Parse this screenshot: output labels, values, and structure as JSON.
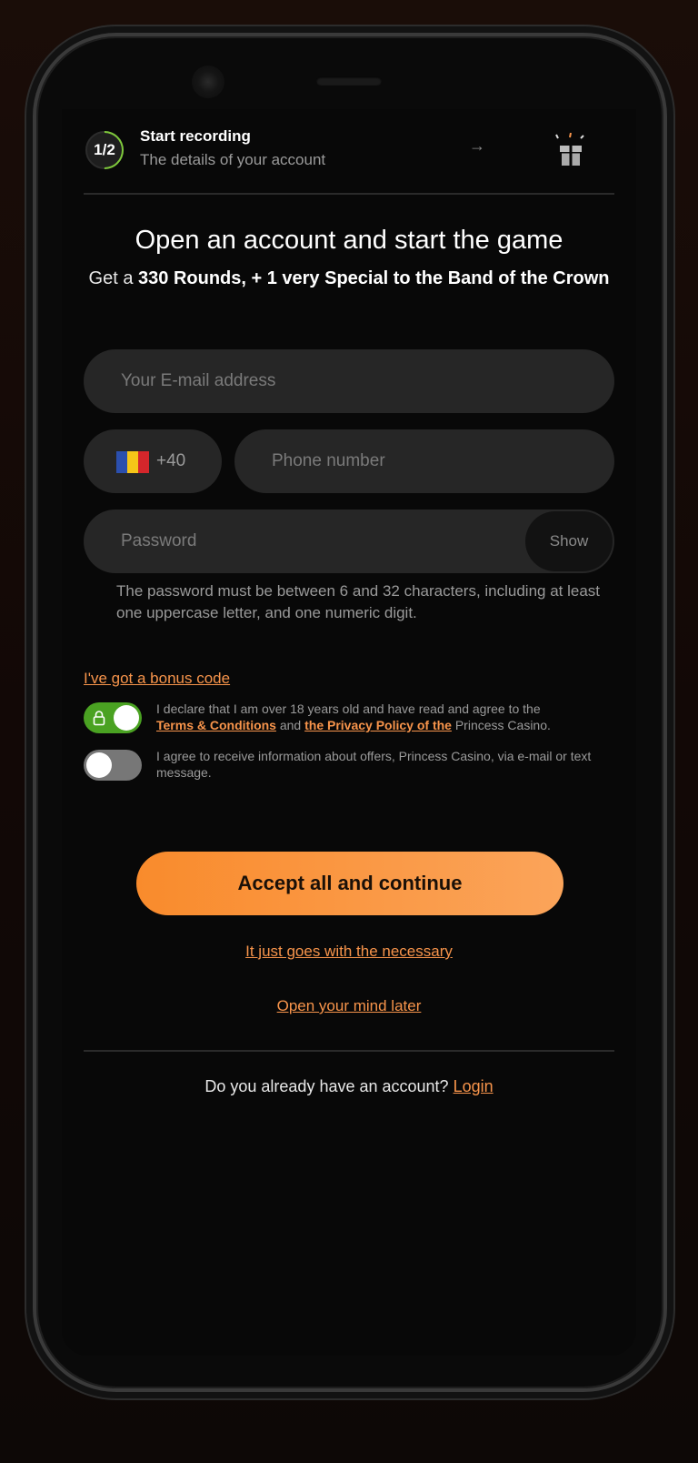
{
  "step": {
    "indicator": "1/2",
    "title": "Start recording",
    "subtitle": "The details of your account"
  },
  "icons": {
    "arrow": "→",
    "gift": "gift-icon",
    "lock": "lock-icon"
  },
  "heading": {
    "title": "Open an account and start the game",
    "subtitle_lead": "Get a",
    "subtitle_bold": "330 Rounds, + 1 very Special to the Band of the Crown"
  },
  "form": {
    "email_placeholder": "Your E-mail address",
    "country_code": "+40",
    "phone_placeholder": "Phone number",
    "password_placeholder": "Password",
    "show_label": "Show",
    "password_hint": "The password must be between 6 and 32 characters, including at least one uppercase letter, and one numeric digit.",
    "bonus_link": "I've got a bonus code"
  },
  "consents": {
    "age": {
      "checked": true,
      "text_before": "I declare that I am over 18 years old and have read and agree to the",
      "terms_link": "Terms & Conditions",
      "and": "and",
      "privacy_link": "the Privacy Policy of the",
      "text_after": "Princess Casino."
    },
    "marketing": {
      "checked": false,
      "text": "I agree to receive information about offers, Princess Casino, via e-mail or text message."
    }
  },
  "actions": {
    "accept_all": "Accept all and continue",
    "necessary_only": "It just goes with the necessary",
    "decide_later": "Open your mind later"
  },
  "footer": {
    "question": "Do you already have an account?",
    "login_link": "Login"
  },
  "colors": {
    "accent": "#f7944b",
    "toggle_on": "#4aa222",
    "progress": "#7ec83b",
    "flag": [
      "#2b4fae",
      "#f5c518",
      "#d4262b"
    ]
  }
}
